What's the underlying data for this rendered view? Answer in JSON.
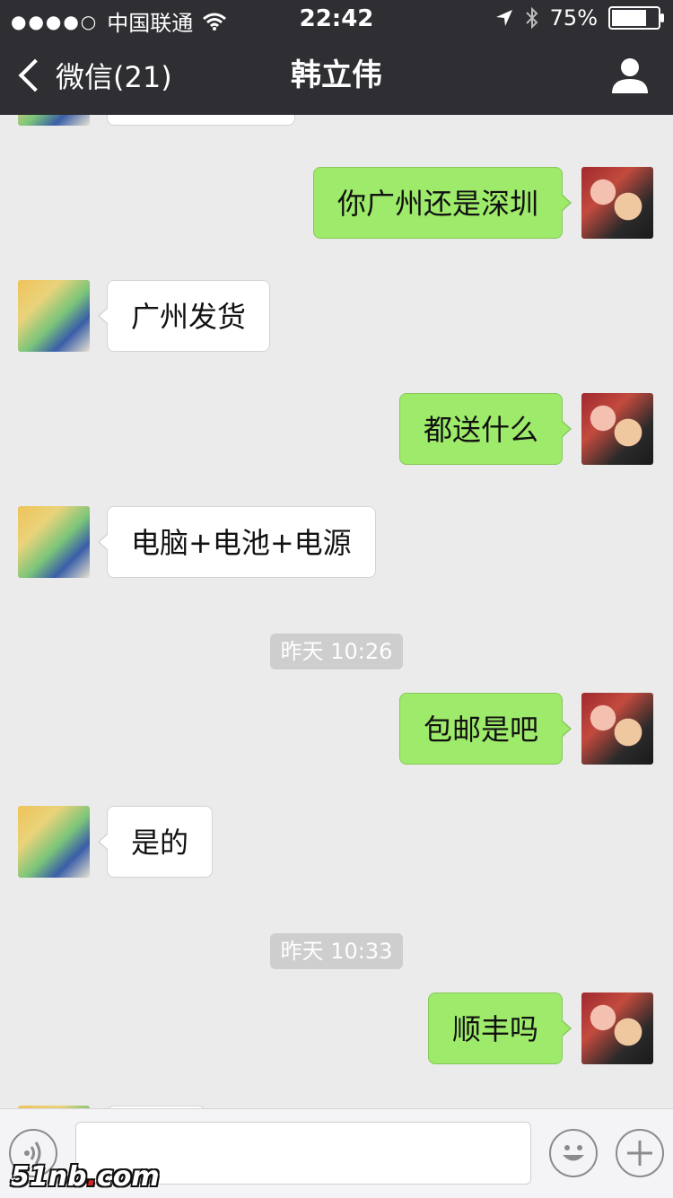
{
  "status_bar": {
    "signal_dots": "●●●●○",
    "carrier": "中国联通",
    "time": "22:42",
    "battery_percent": "75%",
    "battery_level": 0.75
  },
  "navbar": {
    "back_label": "微信(21)",
    "title": "韩立伟"
  },
  "messages": [
    {
      "side": "left",
      "text": "",
      "avatar": "baby"
    },
    {
      "side": "right",
      "text": "你广州还是深圳",
      "avatar": "me"
    },
    {
      "side": "left",
      "text": "广州发货",
      "avatar": "baby"
    },
    {
      "side": "right",
      "text": "都送什么",
      "avatar": "me"
    },
    {
      "side": "left",
      "text": "电脑+电池+电源",
      "avatar": "baby"
    },
    {
      "timestamp": "昨天 10:26"
    },
    {
      "side": "right",
      "text": "包邮是吧",
      "avatar": "me"
    },
    {
      "side": "left",
      "text": "是的",
      "avatar": "baby"
    },
    {
      "timestamp": "昨天 10:33"
    },
    {
      "side": "right",
      "text": "顺丰吗",
      "avatar": "me"
    },
    {
      "side": "left",
      "text": "",
      "avatar": "baby"
    }
  ],
  "input_bar": {
    "text_value": "",
    "icons": [
      "voice-icon",
      "emoji-icon",
      "plus-icon"
    ]
  },
  "watermark": {
    "text_a": "51nb",
    "text_dot": ".",
    "text_b": "com"
  },
  "colors": {
    "nav_bg": "#2e2e33",
    "chat_bg": "#ebebeb",
    "sent_bubble": "#9eea6a",
    "received_bubble": "#ffffff"
  }
}
